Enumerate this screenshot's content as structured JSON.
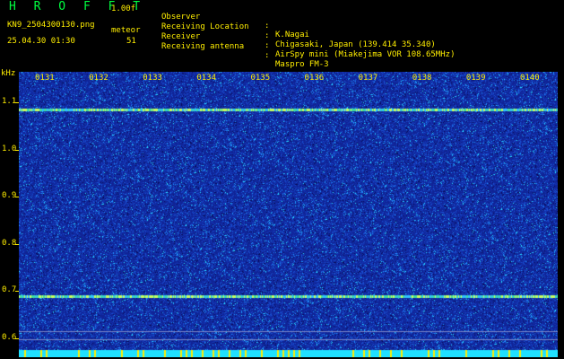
{
  "header": {
    "app_title": "H R O F F T",
    "app_version": "1.00f",
    "file_name": "KN9_2504300130.png",
    "timestamp": "25.04.30 01:30",
    "meteor_label": "meteor",
    "meteor_count": "51"
  },
  "info": [
    {
      "key": "Observer",
      "value": "K.Nagai"
    },
    {
      "key": "Receiving Location",
      "value": "Chigasaki, Japan (139.414 35.340)"
    },
    {
      "key": "Receiver",
      "value": "AirSpy mini (Miakejima VOR 108.65MHz)"
    },
    {
      "key": "Receiving antenna",
      "value": "Maspro FM-3"
    }
  ],
  "colon": ":",
  "axis": {
    "y_unit": "kHz",
    "y_ticks": [
      {
        "label": "1.1",
        "value": 1.1
      },
      {
        "label": "1.0",
        "value": 1.0
      },
      {
        "label": "0.9",
        "value": 0.9
      },
      {
        "label": "0.8",
        "value": 0.8
      },
      {
        "label": "0.7",
        "value": 0.7
      },
      {
        "label": "0.6",
        "value": 0.6
      }
    ],
    "y_range": [
      0.56,
      1.165
    ],
    "x_ticks": [
      "0131",
      "0132",
      "0133",
      "0134",
      "0135",
      "0136",
      "0137",
      "0138",
      "0139",
      "0140"
    ],
    "x_count": 10
  },
  "colors": {
    "label": "#ffee00",
    "title": "#00ff40",
    "background": "#000000",
    "spectrogram_base": "#10249a",
    "bottom_band": "#20e0ff"
  },
  "signals": [
    {
      "frequency_khz": 1.085,
      "intensity": "strong"
    },
    {
      "frequency_khz": 0.689,
      "intensity": "strong"
    },
    {
      "frequency_khz": 0.615,
      "intensity": "reference"
    },
    {
      "frequency_khz": 0.598,
      "intensity": "reference"
    }
  ]
}
